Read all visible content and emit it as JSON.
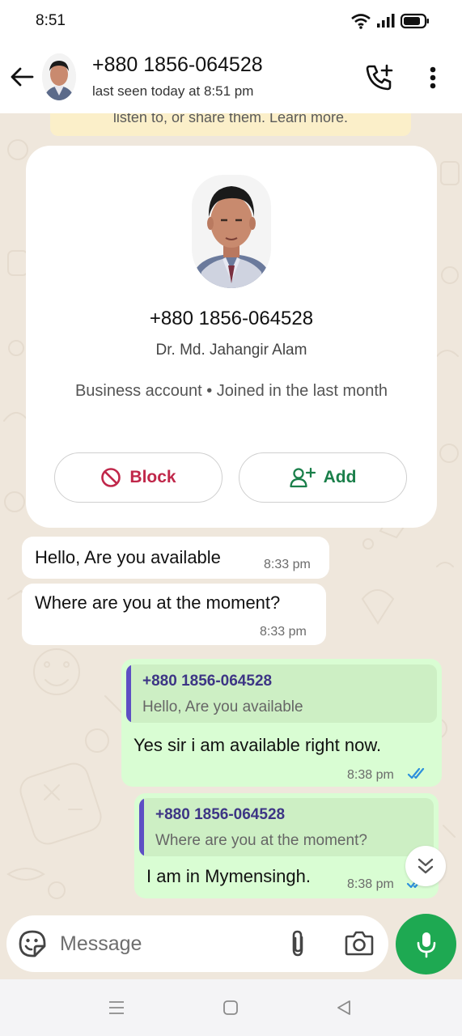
{
  "status_bar": {
    "time": "8:51",
    "icons": [
      "wifi-icon",
      "signal-icon",
      "battery-icon"
    ]
  },
  "header": {
    "contact_number": "+880 1856-064528",
    "last_seen": "last seen today at 8:51 pm",
    "icons": [
      "back-arrow-icon",
      "add-call-icon",
      "more-vert-icon"
    ]
  },
  "notice": {
    "text": "listen to, or share them. Learn more."
  },
  "profile_card": {
    "number": "+880 1856-064528",
    "name": "Dr. Md. Jahangir Alam",
    "info": "Business account • Joined in the last month",
    "block_label": "Block",
    "add_label": "Add",
    "colors": {
      "block": "#c0274a",
      "add": "#1a7f4a"
    }
  },
  "messages": [
    {
      "direction": "incoming",
      "text": "Hello, Are you available",
      "time": "8:33 pm"
    },
    {
      "direction": "incoming",
      "text": "Where are you at the moment?",
      "time": "8:33 pm"
    },
    {
      "direction": "outgoing",
      "quote": {
        "name": "+880 1856-064528",
        "text": "Hello, Are you available"
      },
      "text": "Yes sir i  am available right now.",
      "time": "8:38 pm",
      "status": "read"
    },
    {
      "direction": "outgoing",
      "quote": {
        "name": "+880 1856-064528",
        "text": "Where are you at the moment?"
      },
      "text": "I am in Mymensingh.",
      "time": "8:38 pm",
      "status": "read"
    }
  ],
  "composer": {
    "placeholder": "Message",
    "icons": [
      "sticker-icon",
      "attach-icon",
      "camera-icon",
      "mic-icon"
    ],
    "mic_color": "#1ea952"
  },
  "colors": {
    "outgoing_bubble": "#d9fdd3",
    "incoming_bubble": "#ffffff",
    "quote_bar": "#5d4fc4",
    "read_ticks": "#2d8fdc"
  },
  "nav_bar": {
    "icons": [
      "recents-icon",
      "home-icon",
      "back-icon"
    ]
  }
}
